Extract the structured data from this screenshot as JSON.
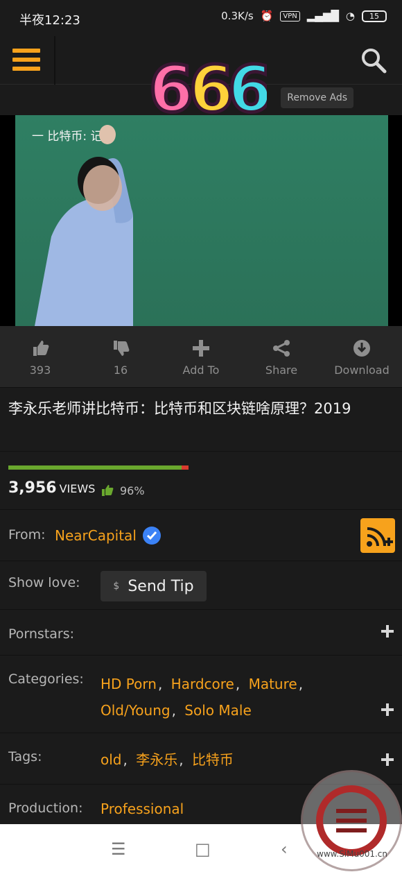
{
  "status": {
    "time": "半夜12:23",
    "speed": "0.3K/s",
    "vpn": "VPN",
    "battery": "15"
  },
  "header": {
    "logo_text": "666",
    "remove_ads": "Remove Ads"
  },
  "video": {
    "board_text": "一 比特币: 记"
  },
  "actions": [
    {
      "label": "393",
      "icon": "thumbs-up-icon"
    },
    {
      "label": "16",
      "icon": "thumbs-down-icon"
    },
    {
      "label": "Add To",
      "icon": "plus-icon"
    },
    {
      "label": "Share",
      "icon": "share-icon"
    },
    {
      "label": "Download",
      "icon": "download-icon"
    }
  ],
  "title": "李永乐老师讲比特币：比特币和区块链啥原理？2019",
  "stats": {
    "views": "3,956",
    "views_label": "VIEWS",
    "rating": "96%",
    "rating_fraction": 0.96
  },
  "from": {
    "label": "From:",
    "channel": "NearCapital"
  },
  "love": {
    "label": "Show love:",
    "currency": "$",
    "button": "Send Tip"
  },
  "pornstars": {
    "label": "Pornstars:"
  },
  "categories": {
    "label": "Categories:",
    "items": [
      "HD Porn",
      "Hardcore",
      "Mature",
      "Old/Young",
      "Solo Male"
    ]
  },
  "tags": {
    "label": "Tags:",
    "items": [
      "old",
      "李永乐",
      "比特币"
    ]
  },
  "production": {
    "label": "Production:",
    "value": "Professional"
  },
  "watermark": {
    "text": "www.SiMu001.cn"
  },
  "colors": {
    "accent": "#f7a21c",
    "background": "#1b1b1b",
    "panel": "#262626",
    "verified": "#3b82f6"
  }
}
